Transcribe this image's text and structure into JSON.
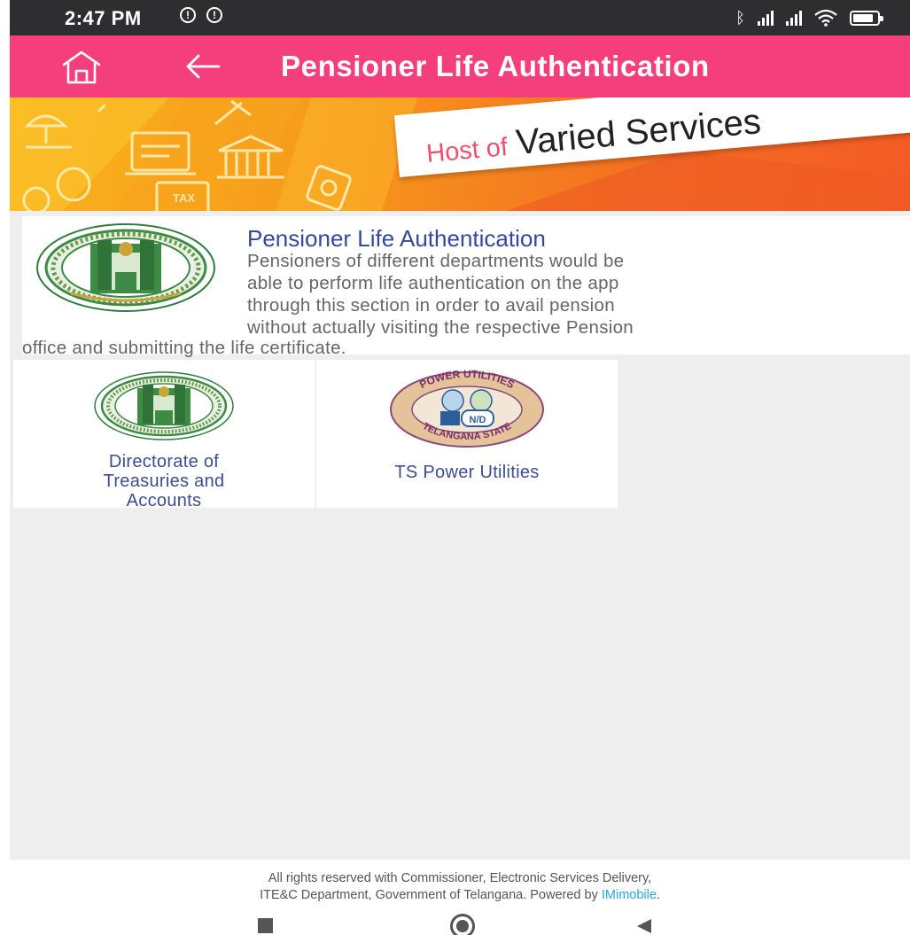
{
  "status_bar": {
    "time": "2:47 PM",
    "alert_glyph": "!",
    "icons": [
      "alert-icon",
      "alert-icon",
      "bluetooth-icon",
      "signal-icon",
      "signal-icon",
      "wifi-icon",
      "battery-icon"
    ]
  },
  "app_bar": {
    "title": "Pensioner Life Authentication",
    "background": "#f53f7c",
    "icons": [
      "home-icon",
      "back-arrow-icon"
    ]
  },
  "banner": {
    "host_text": "Host of",
    "varied_text": "Varied Services"
  },
  "info_card": {
    "title": "Pensioner Life Authentication",
    "description_lines": [
      "Pensioners of different departments would be",
      "able to perform life authentication on the app",
      "through this section in order to avail pension",
      "without actually visiting the respective Pension",
      "office and submitting the life certificate."
    ],
    "emblem": "telangana-emblem"
  },
  "departments": [
    {
      "label_lines": [
        "Directorate of",
        "Treasuries and",
        "Accounts"
      ],
      "logo": "telangana-emblem"
    },
    {
      "label_lines": [
        "TS Power Utilities"
      ],
      "logo": "power-utilities-logo",
      "logo_text": "POWER UTILITIES",
      "logo_text_bottom": "TELANGANA STATE",
      "logo_badge": "N/D"
    }
  ],
  "footer": {
    "line1": "All rights reserved with Commissioner, Electronic Services Delivery,",
    "line2_prefix": "ITE&C Department, Government of Telangana. Powered by ",
    "line2_link": "IMimobile",
    "line2_suffix": "."
  },
  "colors": {
    "accent": "#f53f7c",
    "title_blue": "#34489c",
    "link_blue": "#2ea3dc",
    "content_bg": "#eeeeee"
  }
}
